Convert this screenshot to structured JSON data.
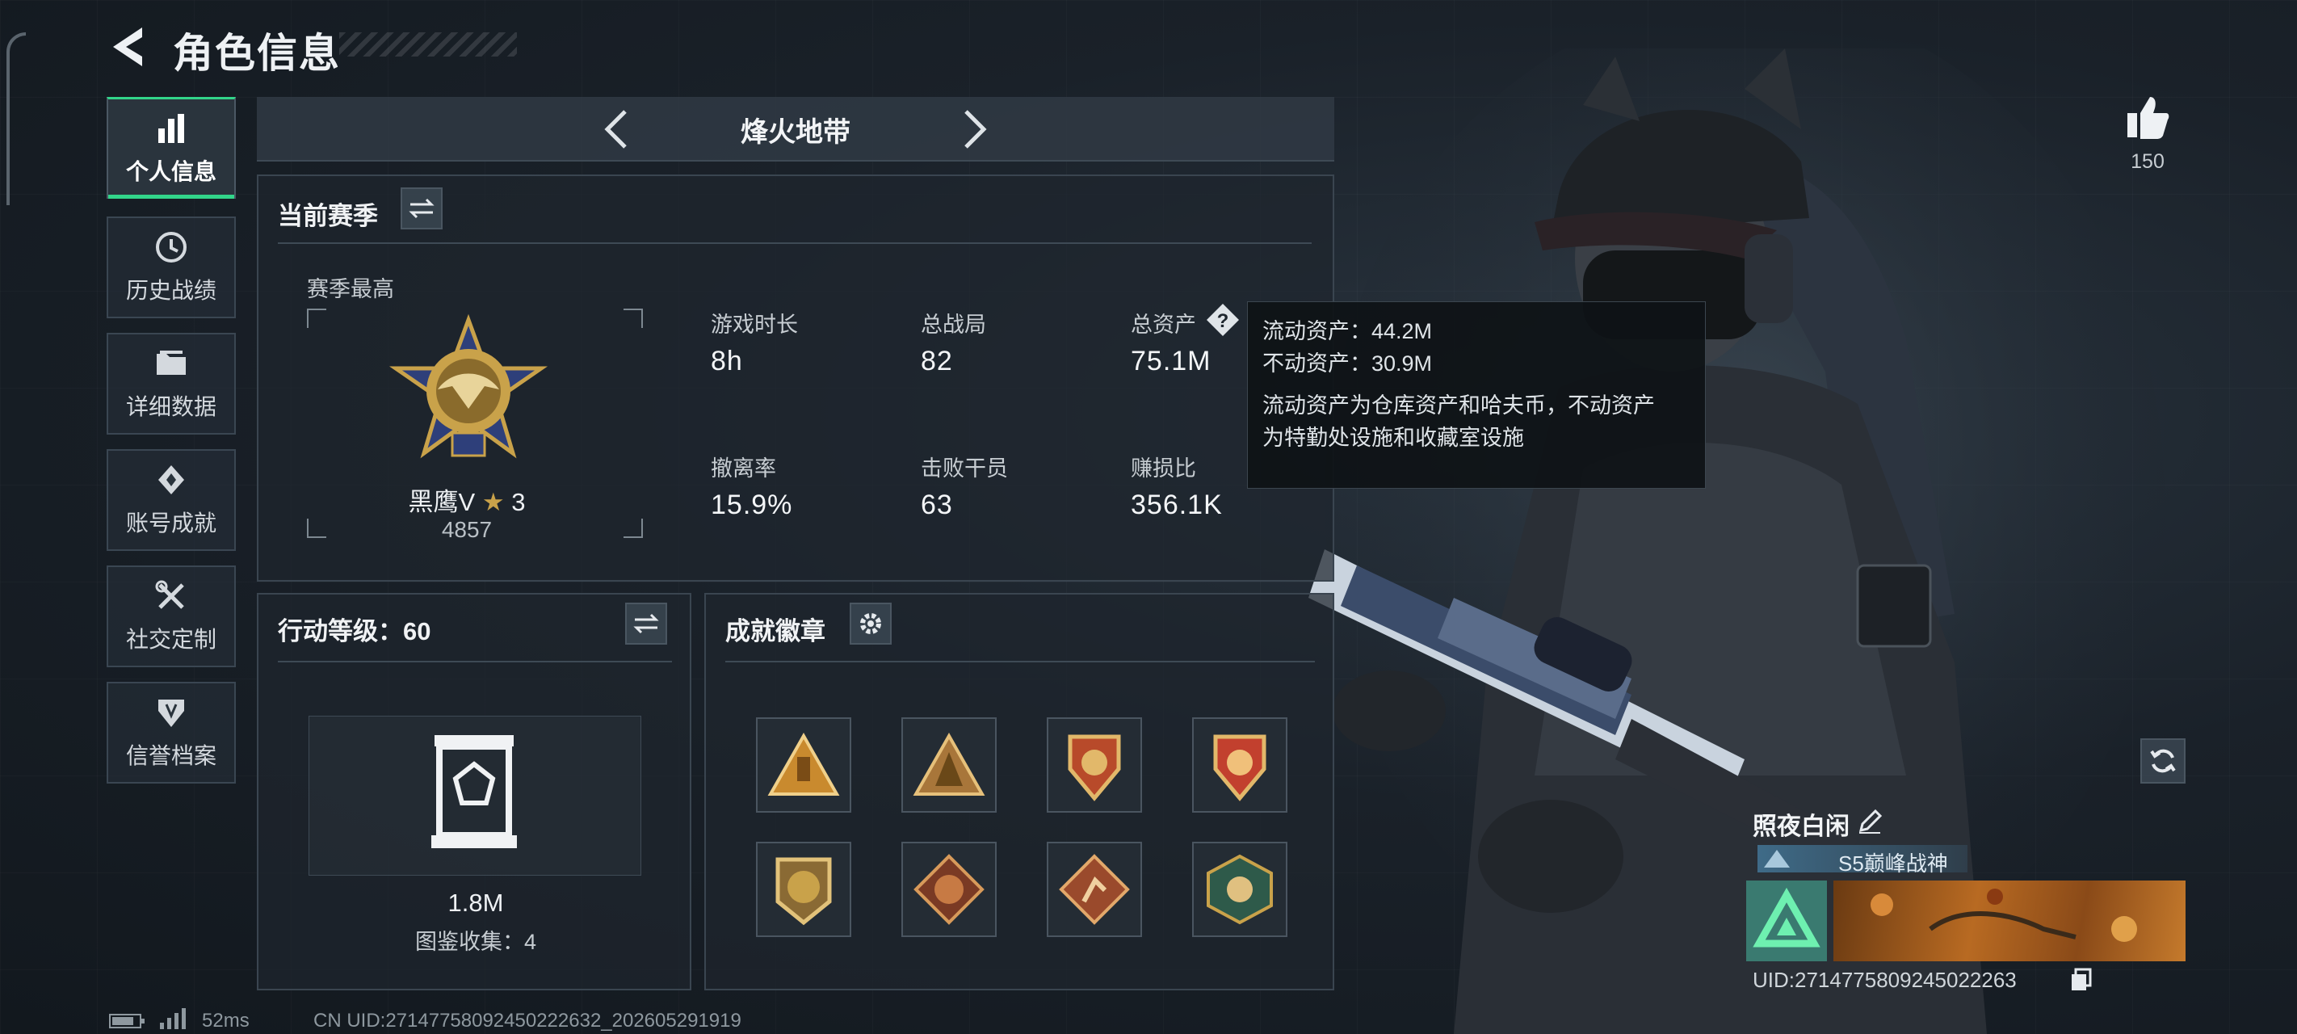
{
  "header": {
    "title": "角色信息"
  },
  "sidebar": {
    "items": [
      {
        "label": "个人信息",
        "icon": "bar-chart-icon",
        "active": true
      },
      {
        "label": "历史战绩",
        "icon": "history-icon"
      },
      {
        "label": "详细数据",
        "icon": "folder-icon"
      },
      {
        "label": "账号成就",
        "icon": "achievement-icon"
      },
      {
        "label": "社交定制",
        "icon": "tools-icon"
      },
      {
        "label": "信誉档案",
        "icon": "shield-icon"
      }
    ]
  },
  "mode": {
    "title": "烽火地带"
  },
  "season": {
    "title": "当前赛季",
    "best_label": "赛季最高",
    "rank_name": "黑鹰V",
    "rank_stars": "3",
    "rank_points": "4857",
    "stats": [
      {
        "label": "游戏时长",
        "value": "8h"
      },
      {
        "label": "总战局",
        "value": "82"
      },
      {
        "label": "总资产",
        "value": "75.1M"
      },
      {
        "label": "撤离率",
        "value": "15.9%"
      },
      {
        "label": "击败干员",
        "value": "63"
      },
      {
        "label": "赚损比",
        "value": "356.1K"
      }
    ]
  },
  "tooltip": {
    "line1": "流动资产：44.2M",
    "line2": "不动资产：30.9M",
    "desc1": "流动资产为仓库资产和哈夫币，不动资产",
    "desc2": "为特勤处设施和收藏室设施"
  },
  "action_level": {
    "title": "行动等级：60",
    "value": "1.8M",
    "collection": "图鉴收集：4"
  },
  "badges": {
    "title": "成就徽章"
  },
  "right": {
    "likes": "150",
    "player_name": "照夜白闲",
    "player_title": "S5巅峰战神",
    "uid_line": "UID:2714775809245022263"
  },
  "status": {
    "ping": "52ms",
    "uid": "CN UID:27147758092450222632_202605291919"
  },
  "colors": {
    "accent": "#32d58a",
    "panel": "#1e262e",
    "gold": "#c9a24a"
  }
}
